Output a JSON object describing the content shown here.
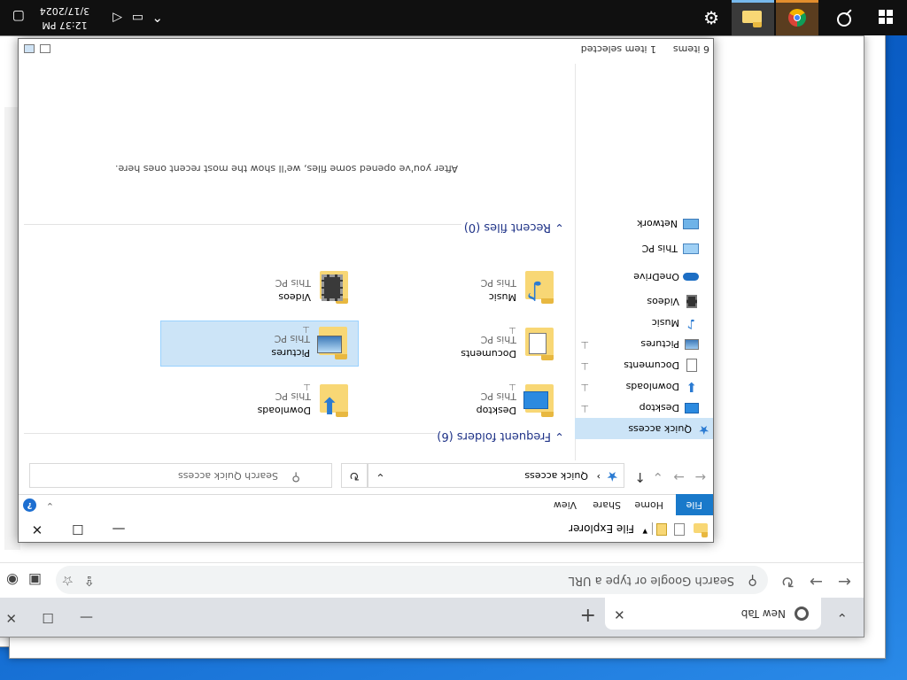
{
  "chrome": {
    "tab_title": "New Tab",
    "new_tab_symbol": "+",
    "address_placeholder": "Search Google or type a URL"
  },
  "explorer": {
    "title": "File Explorer",
    "ribbon_tabs": [
      "File",
      "Home",
      "Share",
      "View"
    ],
    "help_label": "?",
    "address_path": "Quick access",
    "search_placeholder": "Search Quick access",
    "nav": {
      "quick_access": "Quick access",
      "items": [
        {
          "label": "Desktop",
          "icon": "desktop-icon",
          "pinned": true
        },
        {
          "label": "Downloads",
          "icon": "download-arrow-icon",
          "pinned": true
        },
        {
          "label": "Documents",
          "icon": "document-icon",
          "pinned": true
        },
        {
          "label": "Pictures",
          "icon": "picture-icon",
          "pinned": true
        },
        {
          "label": "Music",
          "icon": "music-note-icon",
          "pinned": false
        },
        {
          "label": "Videos",
          "icon": "film-icon",
          "pinned": false
        }
      ],
      "onedrive": "OneDrive",
      "this_pc": "This PC",
      "network": "Network"
    },
    "frequent_header": "Frequent folders (6)",
    "recent_header": "Recent files (0)",
    "recent_empty": "After you've opened some files, we'll show the most recent ones here.",
    "folders": [
      {
        "name": "Desktop",
        "location": "This PC",
        "pinned": true
      },
      {
        "name": "Downloads",
        "location": "This PC",
        "pinned": true
      },
      {
        "name": "Documents",
        "location": "This PC",
        "pinned": true
      },
      {
        "name": "Pictures",
        "location": "This PC",
        "pinned": true
      },
      {
        "name": "Music",
        "location": "This PC",
        "pinned": false
      },
      {
        "name": "Videos",
        "location": "This PC",
        "pinned": false
      }
    ],
    "status": {
      "count": "6 items",
      "selected": "1 item selected"
    }
  },
  "taskbar": {
    "time": "12:37 PM",
    "date": "3/17/2024"
  },
  "colors": {
    "accent": "#1979ca",
    "selection": "#cce4f7",
    "folder": "#f8d775",
    "taskbar": "#101010"
  }
}
